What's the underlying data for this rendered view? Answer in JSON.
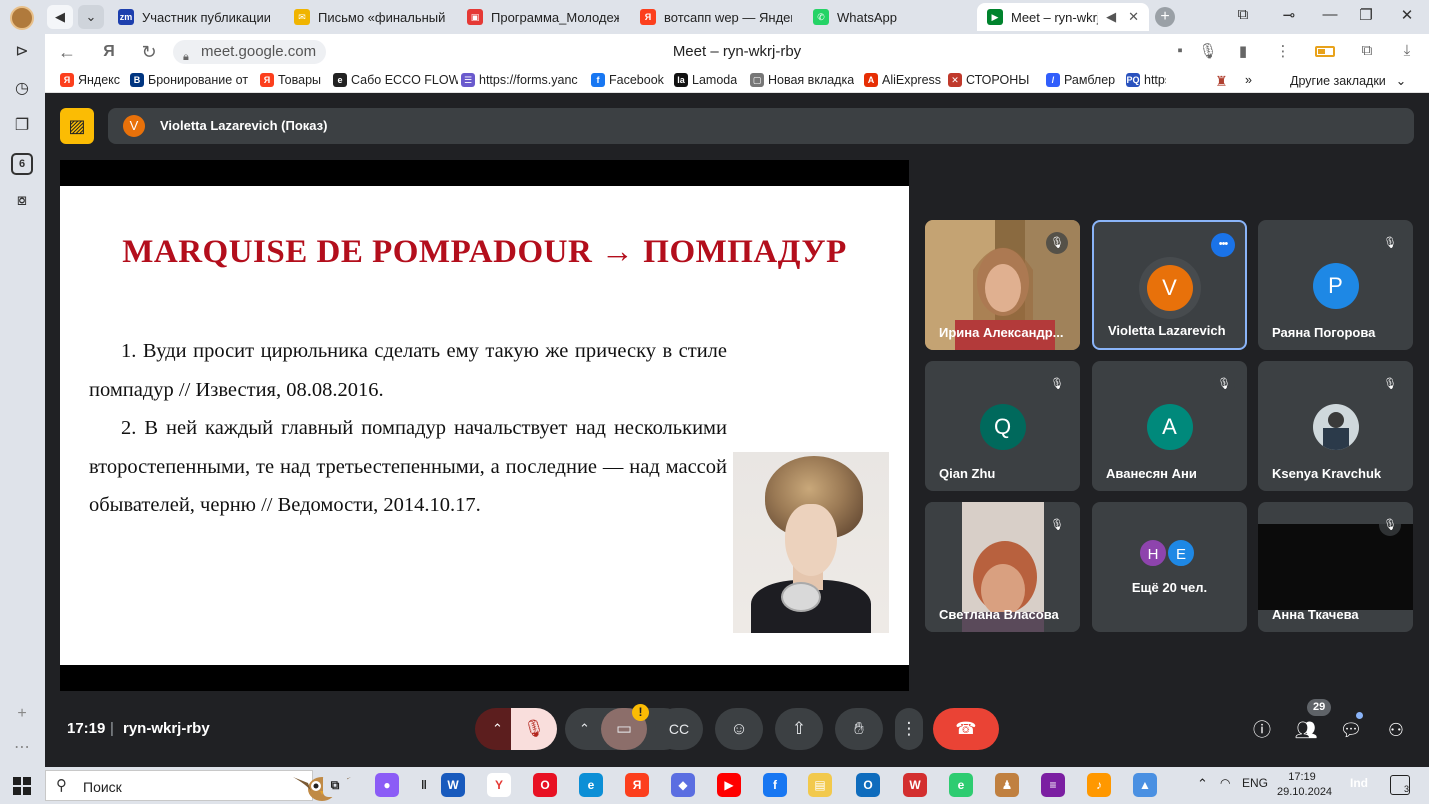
{
  "browser": {
    "tabs": [
      {
        "label": "Участник публикации -",
        "favicon": "zm",
        "color": "#1d3fae"
      },
      {
        "label": "Письмо «финальный ва",
        "favicon": "✉",
        "color": "#f0b400"
      },
      {
        "label": "Программа_Молодежн",
        "favicon": "▣",
        "color": "#e53935"
      },
      {
        "label": "вотсапп wep — Яндекс",
        "favicon": "Я",
        "color": "#fc3f1d"
      },
      {
        "label": "WhatsApp",
        "favicon": "✆",
        "color": "#25d366"
      },
      {
        "label": "Meet – ryn-wkrj-rb",
        "favicon": "▶",
        "color": "#00832d",
        "active": true
      }
    ],
    "url": "meet.google.com",
    "page_title": "Meet – ryn-wkrj-rby",
    "bookmarks": [
      {
        "label": "Яндекс",
        "favicon": "Я",
        "color": "#fc3f1d"
      },
      {
        "label": "Бронирование от",
        "favicon": "B",
        "color": "#003580"
      },
      {
        "label": "Товары",
        "favicon": "Я",
        "color": "#fc3f1d"
      },
      {
        "label": "Сабо ECCO FLOW",
        "favicon": "e",
        "color": "#222222"
      },
      {
        "label": "https://forms.yanc",
        "favicon": "☰",
        "color": "#6a5acd"
      },
      {
        "label": "Facebook",
        "favicon": "f",
        "color": "#1877f2"
      },
      {
        "label": "Lamoda",
        "favicon": "la",
        "color": "#111111"
      },
      {
        "label": "Новая вкладка",
        "favicon": "▢",
        "color": "#777777"
      },
      {
        "label": "AliExpress",
        "favicon": "A",
        "color": "#e62e04"
      },
      {
        "label": "СТОРОНЫ",
        "favicon": "✕",
        "color": "#c0392b"
      },
      {
        "label": "Рамблер",
        "favicon": "/",
        "color": "#315efb"
      },
      {
        "label": "https://ww",
        "favicon": "PQ",
        "color": "#2a52be"
      }
    ],
    "other_bookmarks": "Другие закладки",
    "side_badge": "6"
  },
  "meet": {
    "presenter": {
      "initial": "V",
      "label": "Violetta Lazarevich (Показ)"
    },
    "slide": {
      "title": "MARQUISE DE POMPADOUR → ПОМПАДУР",
      "paragraphs": [
        "1. Вуди просит цирюльника сделать ему такую же прическу в стиле помпадур // Известия, 08.08.2016.",
        "2. В ней каждый главный помпадур начальствует над несколькими второстепенными, те над третьестепенными, а последние — над массой обывателей, черню // Ведомости, 2014.10.17."
      ]
    },
    "participants": [
      {
        "name": "Ирина Александр...",
        "type": "video",
        "muted": true
      },
      {
        "name": "Violetta Lazarevich",
        "initial": "V",
        "color": "#e8710a",
        "active": true
      },
      {
        "name": "Раяна Погорова",
        "initial": "P",
        "color": "#1e88e5",
        "muted": true
      },
      {
        "name": "Qian Zhu",
        "initial": "Q",
        "color": "#00695c",
        "muted": true
      },
      {
        "name": "Аванесян Ани",
        "initial": "A",
        "color": "#00897b",
        "muted": true
      },
      {
        "name": "Ksenya Kravchuk",
        "type": "photo",
        "muted": true
      },
      {
        "name": "Светлана Власова",
        "type": "video",
        "muted": true
      },
      {
        "name": "Ещё 20 чел.",
        "type": "more",
        "avatars": [
          {
            "initial": "H",
            "color": "#8e44ad"
          },
          {
            "initial": "E",
            "color": "#1e88e5"
          }
        ]
      },
      {
        "name": "Анна Ткачева",
        "type": "dark",
        "muted": true
      }
    ],
    "clock": "17:19",
    "separator": "|",
    "meeting_code": "ryn-wkrj-rby",
    "participant_count": "29",
    "camera_warning": "!"
  },
  "taskbar": {
    "search_label": "Поиск",
    "language": "ENG",
    "time": "17:19",
    "date": "29.10.2024",
    "notification_count": "3",
    "apps": [
      {
        "name": "task-view",
        "glyph": "⧉",
        "color": "#dfe3ea"
      },
      {
        "name": "alice",
        "glyph": "●",
        "color": "#8b5cf6"
      },
      {
        "name": "divider",
        "glyph": "‖",
        "color": "#dfe3ea"
      },
      {
        "name": "word",
        "glyph": "W",
        "color": "#185abd"
      },
      {
        "name": "yandex-browser",
        "glyph": "Y",
        "color": "#ffffff"
      },
      {
        "name": "opera",
        "glyph": "O",
        "color": "#e81123"
      },
      {
        "name": "edge",
        "glyph": "e",
        "color": "#0c8fd6"
      },
      {
        "name": "yandex",
        "glyph": "Я",
        "color": "#fc3f1d"
      },
      {
        "name": "copilot",
        "glyph": "◆",
        "color": "#5b6ee1"
      },
      {
        "name": "youtube",
        "glyph": "▶",
        "color": "#ff0000"
      },
      {
        "name": "facebook",
        "glyph": "f",
        "color": "#1877f2"
      },
      {
        "name": "explorer",
        "glyph": "▤",
        "color": "#f2c94c"
      },
      {
        "name": "outlook",
        "glyph": "O",
        "color": "#0f6cbd"
      },
      {
        "name": "wps",
        "glyph": "W",
        "color": "#d32f2f"
      },
      {
        "name": "e-app",
        "glyph": "e",
        "color": "#2ecc71"
      },
      {
        "name": "app-1",
        "glyph": "♟",
        "color": "#c08040"
      },
      {
        "name": "winrar",
        "glyph": "≡",
        "color": "#7b1fa2"
      },
      {
        "name": "music",
        "glyph": "♪",
        "color": "#ff9800"
      },
      {
        "name": "app-2",
        "glyph": "▲",
        "color": "#4a90e2"
      }
    ]
  }
}
